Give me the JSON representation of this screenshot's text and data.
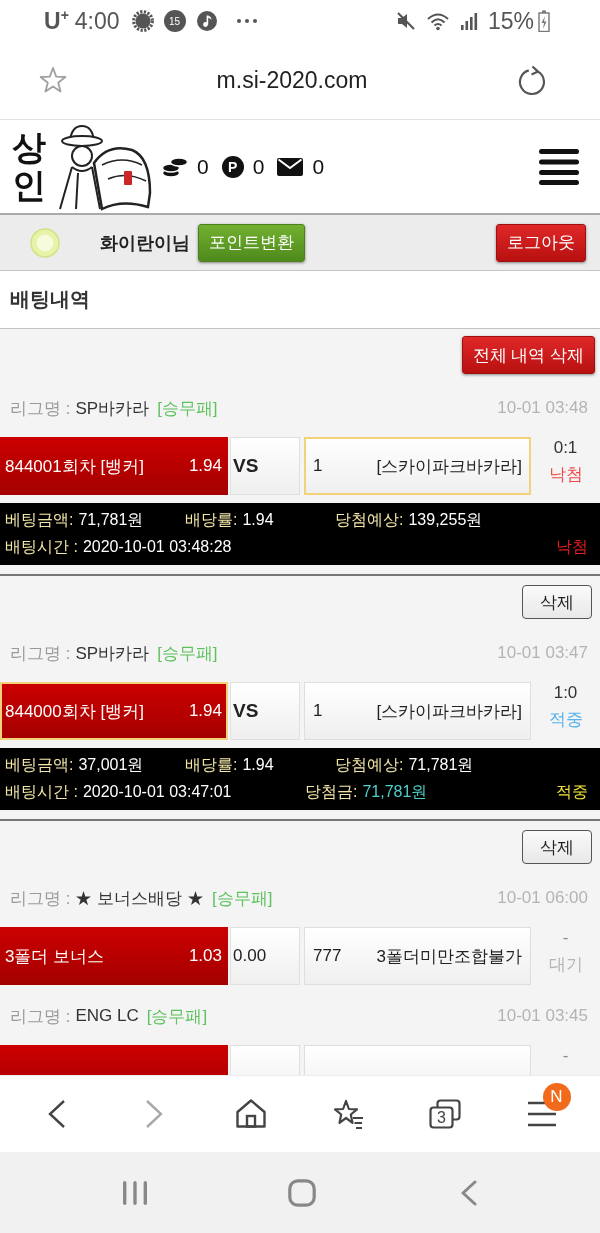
{
  "status_bar": {
    "carrier": "U$^{+}$",
    "time": "4:00",
    "notification_count": "15",
    "battery": "15%"
  },
  "address_bar": {
    "url": "m.si-2020.com"
  },
  "site_header": {
    "logo_text": "상인",
    "coins": "0",
    "points_symbol": "P",
    "points": "0",
    "messages": "0"
  },
  "user_bar": {
    "username": "화이란이님",
    "point_button": "포인트변환",
    "logout_button": "로그아웃"
  },
  "page_title": "배팅내역",
  "delete_all_button": "전체 내역 삭제",
  "bets": [
    {
      "games": [
        {
          "league_label": "리그명 :",
          "league": "SP바카라",
          "market": "[승무패]",
          "date": "10-01 03:48",
          "home": {
            "name": "844001회차 [뱅커]",
            "odds": "1.94",
            "selected": false
          },
          "middle": {
            "kind": "vs",
            "text": "VS"
          },
          "away": {
            "odds": "1",
            "name": "[스카이파크바카라]",
            "selected": true
          },
          "score": "0:1",
          "result": "낙첨",
          "kind": "lose"
        }
      ],
      "summary": {
        "amount_label": "베팅금액:",
        "amount": "71,781원",
        "rate_label": "배당률:",
        "rate": "1.94",
        "expected_label": "당첨예상:",
        "expected": "139,255원",
        "time_label": "배팅시간 :",
        "time": "2020-10-01 03:48:28",
        "result": "낙첨",
        "kind": "lose"
      }
    },
    {
      "delete_button": "삭제",
      "games": [
        {
          "league_label": "리그명 :",
          "league": "SP바카라",
          "market": "[승무패]",
          "date": "10-01 03:47",
          "home": {
            "name": "844000회차 [뱅커]",
            "odds": "1.94",
            "selected": true
          },
          "middle": {
            "kind": "vs",
            "text": "VS"
          },
          "away": {
            "odds": "1",
            "name": "[스카이파크바카라]",
            "selected": false
          },
          "score": "1:0",
          "result": "적중",
          "kind": "win"
        }
      ],
      "summary": {
        "amount_label": "베팅금액:",
        "amount": "37,001원",
        "rate_label": "배당률:",
        "rate": "1.94",
        "expected_label": "당첨예상:",
        "expected": "71,781원",
        "time_label": "배팅시간 :",
        "time": "2020-10-01 03:47:01",
        "winnings_label": "당첨금:",
        "winnings": "71,781원",
        "result": "적중",
        "kind": "win"
      }
    },
    {
      "delete_button": "삭제",
      "games": [
        {
          "league_label": "리그명 :",
          "league": "★ 보너스배당 ★",
          "market": "[승무패]",
          "date": "10-01 06:00",
          "home": {
            "name": "3폴더 보너스",
            "odds": "1.03",
            "selected": false
          },
          "middle": {
            "kind": "odds",
            "text": "0.00"
          },
          "away": {
            "odds": "777",
            "name": "3폴더미만조합불가",
            "selected": false
          },
          "score": "-",
          "result": "대기",
          "kind": "pending"
        },
        {
          "league_label": "리그명 :",
          "league": "ENG LC",
          "market": "[승무패]",
          "date": "10-01 03:45",
          "home": {
            "selected": false
          },
          "away": {
            "selected": false
          },
          "score": "-"
        }
      ]
    }
  ],
  "toolbar": {
    "forward_disabled": true,
    "tab_count": "3",
    "menu_badge": "N"
  }
}
